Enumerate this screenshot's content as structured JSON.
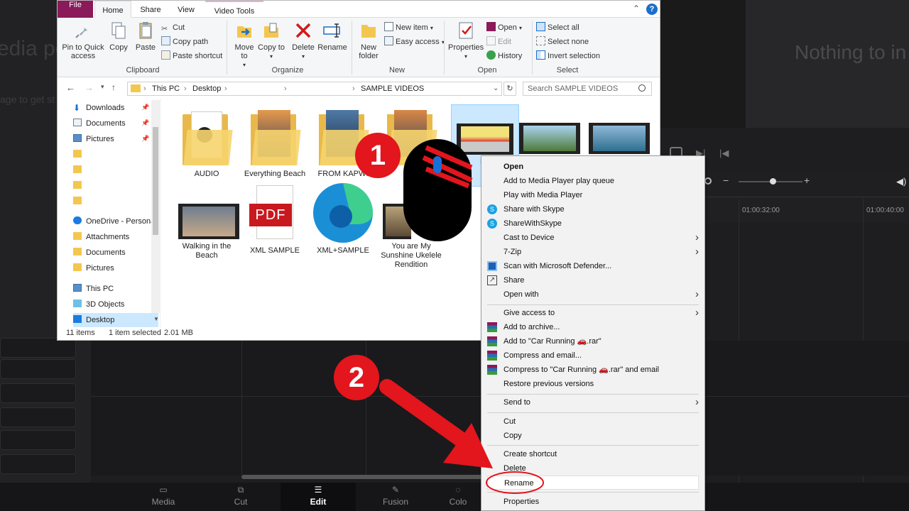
{
  "background_app": {
    "media_pool_title": "edia po",
    "media_pool_sub": "age to get st",
    "viewer_empty": "Nothing to in",
    "timecodes": [
      "01:00:32:00",
      "01:00:40:00"
    ],
    "bottom_nav": [
      {
        "label": "Media",
        "icon": "media-icon"
      },
      {
        "label": "Cut",
        "icon": "cut-page-icon"
      },
      {
        "label": "Edit",
        "icon": "edit-page-icon",
        "active": true
      },
      {
        "label": "Fusion",
        "icon": "fusion-icon"
      },
      {
        "label": "Colo",
        "icon": "color-icon"
      }
    ]
  },
  "explorer": {
    "tabs": {
      "file": "File",
      "home": "Home",
      "share": "Share",
      "view": "View",
      "video_tools": "Video Tools"
    },
    "ribbon": {
      "clipboard": {
        "label": "Clipboard",
        "pin": "Pin to Quick access",
        "copy": "Copy",
        "paste": "Paste",
        "cut": "Cut",
        "copy_path": "Copy path",
        "paste_shortcut": "Paste shortcut"
      },
      "organize": {
        "label": "Organize",
        "move_to": "Move to",
        "copy_to": "Copy to",
        "delete": "Delete",
        "rename": "Rename"
      },
      "new": {
        "label": "New",
        "new_folder": "New folder",
        "new_item": "New item",
        "easy_access": "Easy access"
      },
      "open": {
        "label": "Open",
        "properties": "Properties",
        "open": "Open",
        "edit": "Edit",
        "history": "History"
      },
      "select": {
        "label": "Select",
        "select_all": "Select all",
        "select_none": "Select none",
        "invert": "Invert selection"
      }
    },
    "address": {
      "this_pc": "This PC",
      "desktop": "Desktop",
      "folder": "SAMPLE VIDEOS"
    },
    "search_placeholder": "Search SAMPLE VIDEOS",
    "nav": {
      "downloads": "Downloads",
      "documents": "Documents",
      "pictures": "Pictures",
      "onedrive": "OneDrive - Persona",
      "attachments": "Attachments",
      "od_documents": "Documents",
      "od_pictures": "Pictures",
      "this_pc": "This PC",
      "objects3d": "3D Objects",
      "desktop": "Desktop"
    },
    "files": [
      {
        "name": "AUDIO",
        "type": "folder"
      },
      {
        "name": "Everything Beach",
        "type": "folder"
      },
      {
        "name": "FROM KAPWI",
        "type": "folder"
      },
      {
        "name": "",
        "type": "folder"
      },
      {
        "name": "Ru",
        "type": "video",
        "selected": true
      },
      {
        "name": "",
        "type": "video"
      },
      {
        "name": "",
        "type": "video"
      },
      {
        "name": "Walking in the Beach",
        "type": "video"
      },
      {
        "name": "XML SAMPLE",
        "type": "pdf"
      },
      {
        "name": "XML+SAMPLE",
        "type": "edge"
      },
      {
        "name": "You are My Sunshine Ukelele Rendition",
        "type": "video"
      }
    ],
    "pdf_badge": "PDF",
    "status": {
      "count": "11 items",
      "selected": "1 item selected",
      "size": "2.01 MB"
    }
  },
  "context_menu": {
    "items": [
      {
        "label": "Open",
        "bold": true
      },
      {
        "label": "Add to Media Player play queue"
      },
      {
        "label": "Play with Media Player"
      },
      {
        "label": "Share with Skype",
        "icon": "skype-icon"
      },
      {
        "label": "ShareWithSkype",
        "icon": "skype-icon"
      },
      {
        "label": "Cast to Device",
        "submenu": true
      },
      {
        "label": "7-Zip",
        "submenu": true
      },
      {
        "label": "Scan with Microsoft Defender...",
        "icon": "defender-icon"
      },
      {
        "label": "Share",
        "icon": "share-icon"
      },
      {
        "label": "Open with",
        "submenu": true
      },
      {
        "label": "Give access to",
        "submenu": true
      },
      {
        "label": "Add to archive...",
        "icon": "winrar-icon"
      },
      {
        "label": "Add to \"Car Running 🚗.rar\"",
        "icon": "winrar-icon"
      },
      {
        "label": "Compress and email...",
        "icon": "winrar-icon"
      },
      {
        "label": "Compress to \"Car Running 🚗.rar\" and email",
        "icon": "winrar-icon"
      },
      {
        "label": "Restore previous versions"
      },
      {
        "label": "Send to",
        "submenu": true
      },
      {
        "label": "Cut"
      },
      {
        "label": "Copy"
      },
      {
        "label": "Create shortcut"
      },
      {
        "label": "Delete"
      },
      {
        "label": "Rename",
        "highlighted": true
      },
      {
        "label": "Properties"
      }
    ]
  },
  "annotations": {
    "step1": "1",
    "step2": "2",
    "accent": "#e3151d"
  }
}
